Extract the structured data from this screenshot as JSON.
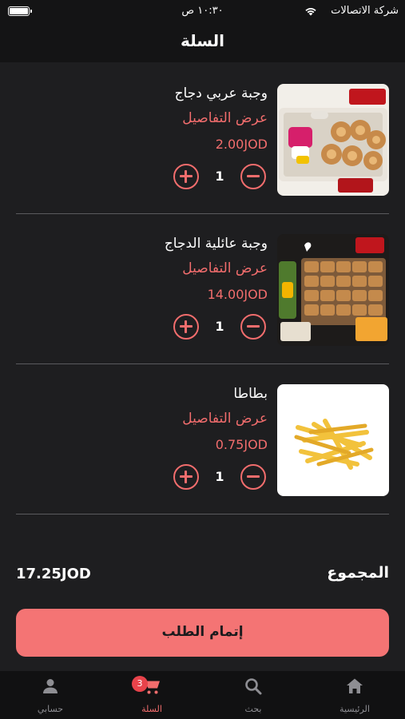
{
  "status_bar": {
    "carrier": "شركة الاتصالات",
    "time": "١٠:٣٠ ص"
  },
  "header": {
    "title": "السلة"
  },
  "cart": {
    "details_label": "عرض التفاصيل",
    "items": [
      {
        "name": "وجبة عربي دجاج",
        "price": "2.00JOD",
        "quantity": "1",
        "image": "chicken-arabi-meal-photo"
      },
      {
        "name": "وجبة عائلية الدجاج",
        "price": "14.00JOD",
        "quantity": "1",
        "image": "chicken-family-meal-photo"
      },
      {
        "name": "بطاطا",
        "price": "0.75JOD",
        "quantity": "1",
        "image": "french-fries-photo"
      }
    ]
  },
  "summary": {
    "total_label": "المجموع",
    "total_value": "17.25JOD"
  },
  "checkout": {
    "label": "إتمام الطلب"
  },
  "nav": {
    "items": [
      {
        "label": "الرئيسية",
        "icon": "home-icon"
      },
      {
        "label": "بحث",
        "icon": "search-icon"
      },
      {
        "label": "السلة",
        "icon": "cart-icon",
        "badge": "3"
      },
      {
        "label": "حسابي",
        "icon": "person-icon"
      }
    ]
  },
  "colors": {
    "accent": "#f26d6d",
    "button": "#f47474",
    "background": "#1e1e20",
    "bar": "#141415",
    "badge": "#e8434b"
  }
}
